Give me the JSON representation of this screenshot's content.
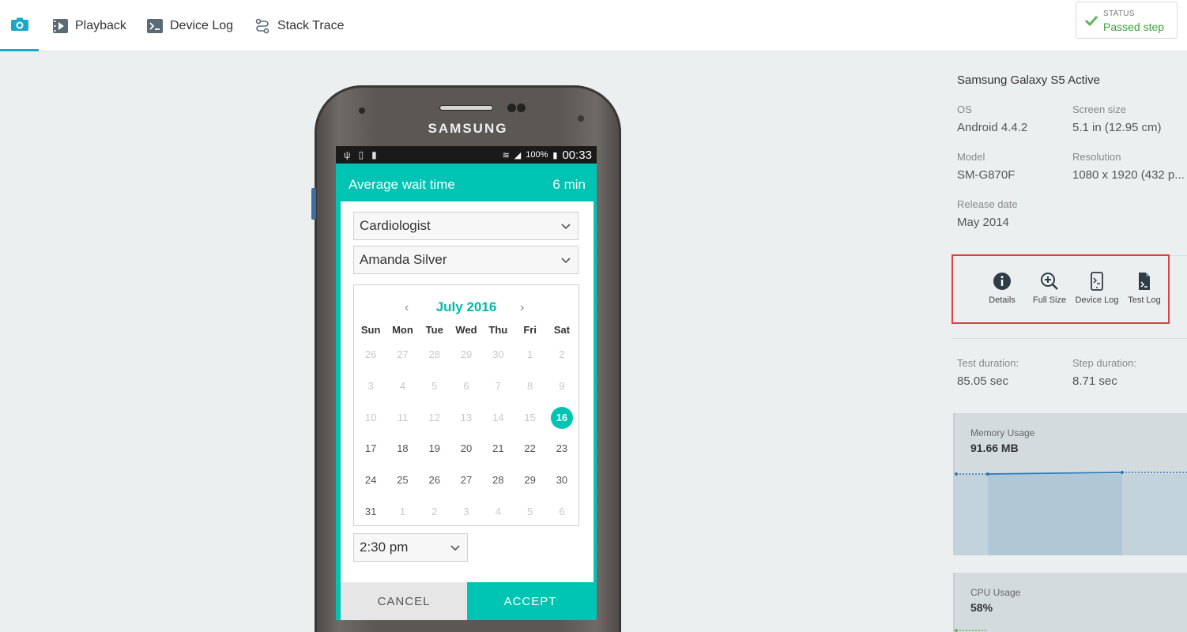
{
  "tabs": {
    "camera_icon": "camera-icon",
    "playback": "Playback",
    "device_log": "Device Log",
    "stack_trace": "Stack Trace"
  },
  "status": {
    "label": "STATUS",
    "value": "Passed step",
    "color": "#3aa03a"
  },
  "phone": {
    "brand": "SAMSUNG",
    "statusbar": {
      "battery": "100%",
      "time": "00:33"
    },
    "app": {
      "wait_label": "Average wait time",
      "wait_value": "6 min",
      "specialty": "Cardiologist",
      "doctor": "Amanda Silver",
      "calendar": {
        "month": "July 2016",
        "prev_icon": "chevron-left-icon",
        "next_icon": "chevron-right-icon",
        "weekdays": [
          "Sun",
          "Mon",
          "Tue",
          "Wed",
          "Thu",
          "Fri",
          "Sat"
        ],
        "days": [
          {
            "d": "26",
            "muted": true
          },
          {
            "d": "27",
            "muted": true
          },
          {
            "d": "28",
            "muted": true
          },
          {
            "d": "29",
            "muted": true
          },
          {
            "d": "30",
            "muted": true
          },
          {
            "d": "1",
            "muted": true
          },
          {
            "d": "2",
            "muted": true
          },
          {
            "d": "3",
            "muted": true
          },
          {
            "d": "4",
            "muted": true
          },
          {
            "d": "5",
            "muted": true
          },
          {
            "d": "6",
            "muted": true
          },
          {
            "d": "7",
            "muted": true
          },
          {
            "d": "8",
            "muted": true
          },
          {
            "d": "9",
            "muted": true
          },
          {
            "d": "10",
            "muted": true
          },
          {
            "d": "11",
            "muted": true
          },
          {
            "d": "12",
            "muted": true
          },
          {
            "d": "13",
            "muted": true
          },
          {
            "d": "14",
            "muted": true
          },
          {
            "d": "15",
            "muted": true
          },
          {
            "d": "16",
            "selected": true
          },
          {
            "d": "17"
          },
          {
            "d": "18"
          },
          {
            "d": "19"
          },
          {
            "d": "20"
          },
          {
            "d": "21"
          },
          {
            "d": "22"
          },
          {
            "d": "23"
          },
          {
            "d": "24"
          },
          {
            "d": "25"
          },
          {
            "d": "26"
          },
          {
            "d": "27"
          },
          {
            "d": "28"
          },
          {
            "d": "29"
          },
          {
            "d": "30"
          },
          {
            "d": "31"
          },
          {
            "d": "1",
            "muted": true
          },
          {
            "d": "2",
            "muted": true
          },
          {
            "d": "3",
            "muted": true
          },
          {
            "d": "4",
            "muted": true
          },
          {
            "d": "5",
            "muted": true
          },
          {
            "d": "6",
            "muted": true
          }
        ]
      },
      "time": "2:30 pm",
      "cancel": "CANCEL",
      "accept": "ACCEPT",
      "accent": "#00c4b3"
    }
  },
  "device": {
    "name": "Samsung Galaxy S5 Active",
    "specs": [
      {
        "label": "OS",
        "value": "Android 4.4.2"
      },
      {
        "label": "Screen size",
        "value": "5.1 in (12.95 cm)"
      },
      {
        "label": "Model",
        "value": "SM-G870F"
      },
      {
        "label": "Resolution",
        "value": "1080 x 1920 (432 p..."
      },
      {
        "label": "Release date",
        "value": "May 2014"
      }
    ]
  },
  "actions": [
    {
      "label": "Details",
      "icon": "info-icon"
    },
    {
      "label": "Full Size",
      "icon": "zoom-in-icon"
    },
    {
      "label": "Device Log",
      "icon": "device-log-icon"
    },
    {
      "label": "Test Log",
      "icon": "test-log-icon"
    }
  ],
  "durations": {
    "test_label": "Test duration:",
    "test_value": "85.05 sec",
    "step_label": "Step duration:",
    "step_value": "8.71 sec"
  },
  "memory": {
    "label": "Memory Usage",
    "value": "91.66 MB"
  },
  "cpu": {
    "label": "CPU Usage",
    "value": "58%"
  }
}
